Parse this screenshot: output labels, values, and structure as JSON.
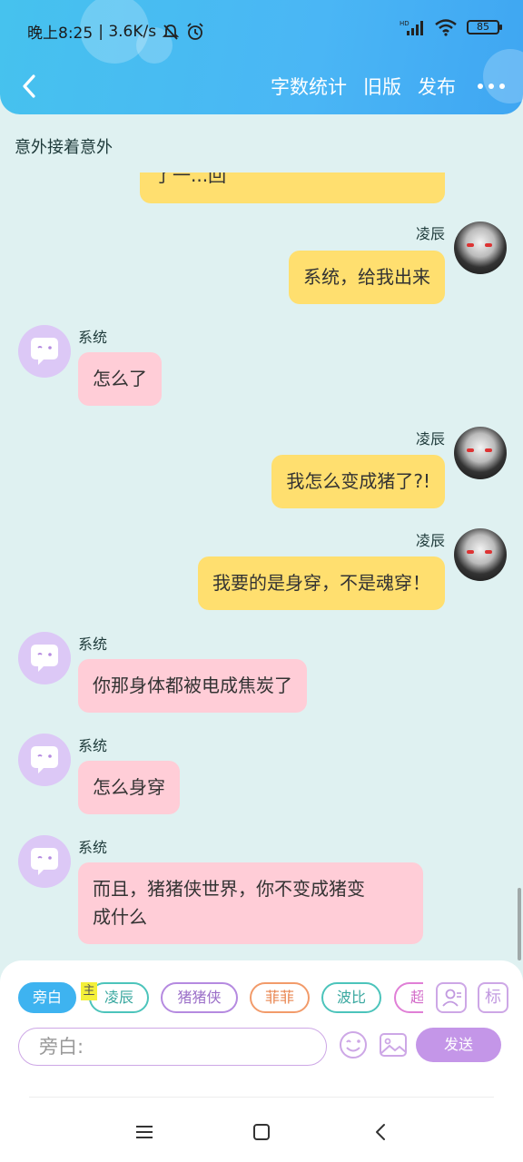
{
  "status_bar": {
    "time": "晚上8:25",
    "speed": "| 3.6K/s",
    "battery": "85",
    "signal_label": "HD"
  },
  "header": {
    "actions": [
      "字数统计",
      "旧版",
      "发布"
    ]
  },
  "story": {
    "title": "意外接着意外"
  },
  "messages": {
    "partial_text": "了一...回",
    "m1": {
      "name": "凌辰",
      "text": "系统，给我出来"
    },
    "m2": {
      "name": "系统",
      "text": "怎么了"
    },
    "m3": {
      "name": "凌辰",
      "text": "我怎么变成猪了?!"
    },
    "m4": {
      "name": "凌辰",
      "text": "我要的是身穿，不是魂穿！"
    },
    "m5": {
      "name": "系统",
      "text": "你那身体都被电成焦炭了"
    },
    "m6": {
      "name": "系统",
      "text": "怎么身穿"
    },
    "m7": {
      "name": "系统",
      "text_line1": "而且，猪猪侠世界，你不变成猪变",
      "text_line2": "成什么"
    }
  },
  "input_panel": {
    "chips": [
      "旁白",
      "凌辰",
      "猪猪侠",
      "菲菲",
      "波比",
      "超"
    ],
    "main_tag": "主",
    "tag_button": "标",
    "placeholder": "旁白:",
    "send_label": "发送"
  },
  "colors": {
    "header_start": "#46c2ee",
    "header_end": "#3fa6f2",
    "page_bg": "#dff1f1",
    "user_bubble": "#ffdf6f",
    "system_bubble": "#ffcdd7",
    "accent_purple": "#c496e8",
    "chip_active": "#3eb3f0"
  }
}
